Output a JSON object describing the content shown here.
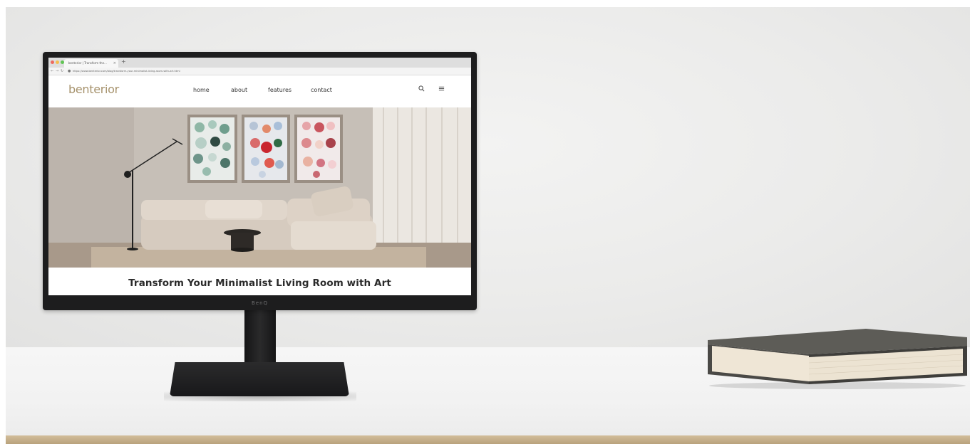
{
  "browser": {
    "tab_title": "benterior | Transform the...",
    "tab_close": "×",
    "new_tab": "+",
    "url": "https://www.benterior.com/blog/transform-your-minimalist-living-room-with-art.html"
  },
  "site": {
    "logo": "benterior",
    "nav": [
      "home",
      "about",
      "features",
      "contact"
    ],
    "headline": "Transform Your Minimalist Living Room with Art",
    "icons": {
      "search": "search-icon",
      "menu": "menu-icon"
    }
  },
  "monitor": {
    "brand": "BenQ"
  },
  "colors": {
    "logo": "#a6926c",
    "bezel": "#1d1d1e",
    "headline": "#2b2b2b"
  }
}
